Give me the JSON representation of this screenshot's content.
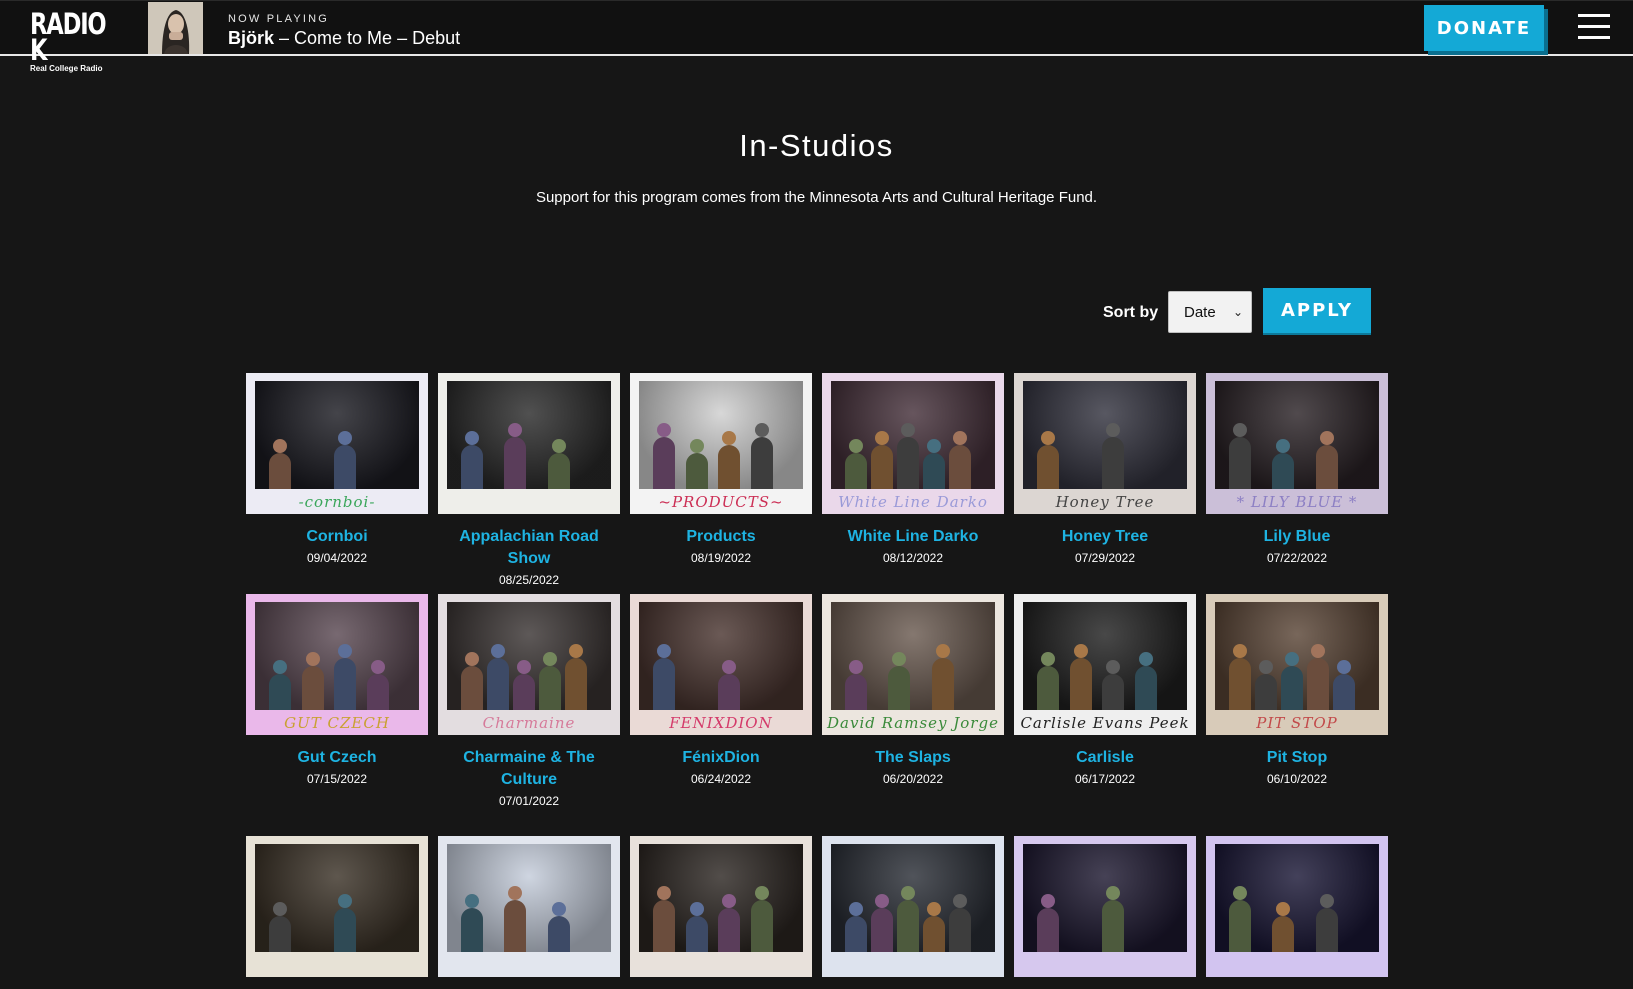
{
  "header": {
    "logo_main": "RADIO K",
    "logo_sub": "Real College Radio",
    "now_playing_label": "NOW PLAYING",
    "track_artist": "Björk",
    "track_rest": " – Come to Me – Debut",
    "donate_label": "DONATE"
  },
  "page": {
    "title": "In-Studios",
    "subtitle": "Support for this program comes from the Minnesota Arts and Cultural Heritage Fund."
  },
  "sort": {
    "label": "Sort by",
    "selected": "Date",
    "apply_label": "APPLY"
  },
  "colors": {
    "accent": "#14a9d6",
    "link": "#1eb3e2",
    "background": "#161616"
  },
  "sessions": [
    {
      "title": "Cornboi",
      "date": "09/04/2022",
      "caption": "-cornboi-",
      "caption_color": "#3aa65a",
      "frame": "#ecebf4",
      "scene": "#1b1b22"
    },
    {
      "title": "Appalachian Road Show",
      "date": "08/25/2022",
      "caption": "",
      "caption_color": "#2c8a5a",
      "frame": "#eeeeea",
      "scene": "#2a2a2a"
    },
    {
      "title": "Products",
      "date": "08/19/2022",
      "caption": "~PRODUCTS~",
      "caption_color": "#cc2f55",
      "frame": "#f3f3f3",
      "scene": "#cfcfcf"
    },
    {
      "title": "White Line Darko",
      "date": "08/12/2022",
      "caption": "White Line Darko",
      "caption_color": "#9a9ad8",
      "frame": "#ead8ea",
      "scene": "#45303a"
    },
    {
      "title": "Honey Tree",
      "date": "07/29/2022",
      "caption": "Honey Tree",
      "caption_color": "#444444",
      "frame": "#dcd6d2",
      "scene": "#33333f"
    },
    {
      "title": "Lily Blue",
      "date": "07/22/2022",
      "caption": "* LILY BLUE *",
      "caption_color": "#8c7fc4",
      "frame": "#cbbfd8",
      "scene": "#2a2226"
    },
    {
      "title": "Gut Czech",
      "date": "07/15/2022",
      "caption": "GUT CZECH",
      "caption_color": "#c9a132",
      "frame": "#eab8ea",
      "scene": "#5a4852"
    },
    {
      "title": "Charmaine & The Culture",
      "date": "07/01/2022",
      "caption": "Charmaine",
      "caption_color": "#d67a9a",
      "frame": "#e3dde0",
      "scene": "#3a3433"
    },
    {
      "title": "FénixDion",
      "date": "06/24/2022",
      "caption": "FENIXDION",
      "caption_color": "#d43a6a",
      "frame": "#eadad6",
      "scene": "#4a3530"
    },
    {
      "title": "The Slaps",
      "date": "06/20/2022",
      "caption": "David Ramsey Jorge",
      "caption_color": "#3a8a3a",
      "frame": "#ece6df",
      "scene": "#6a5a50"
    },
    {
      "title": "Carlisle",
      "date": "06/17/2022",
      "caption": "Carlisle Evans Peek",
      "caption_color": "#222222",
      "frame": "#efefef",
      "scene": "#202020"
    },
    {
      "title": "Pit Stop",
      "date": "06/10/2022",
      "caption": "PIT STOP",
      "caption_color": "#c24a4a",
      "frame": "#d8cbb9",
      "scene": "#5a4536"
    },
    {
      "title": "",
      "date": "",
      "caption": "",
      "caption_color": "#333333",
      "frame": "#e7e2d6",
      "scene": "#3b3227"
    },
    {
      "title": "",
      "date": "",
      "caption": "",
      "caption_color": "#333333",
      "frame": "#e2e6ee",
      "scene": "#c4ccda"
    },
    {
      "title": "",
      "date": "",
      "caption": "",
      "caption_color": "#333333",
      "frame": "#e8e1db",
      "scene": "#2c2622"
    },
    {
      "title": "",
      "date": "",
      "caption": "",
      "caption_color": "#333333",
      "frame": "#dde3ee",
      "scene": "#2a2e36"
    },
    {
      "title": "",
      "date": "",
      "caption": "",
      "caption_color": "#333333",
      "frame": "#d6c8ee",
      "scene": "#1d1830"
    },
    {
      "title": "",
      "date": "",
      "caption": "",
      "caption_color": "#333333",
      "frame": "#d2c4f0",
      "scene": "#1a1736"
    }
  ]
}
